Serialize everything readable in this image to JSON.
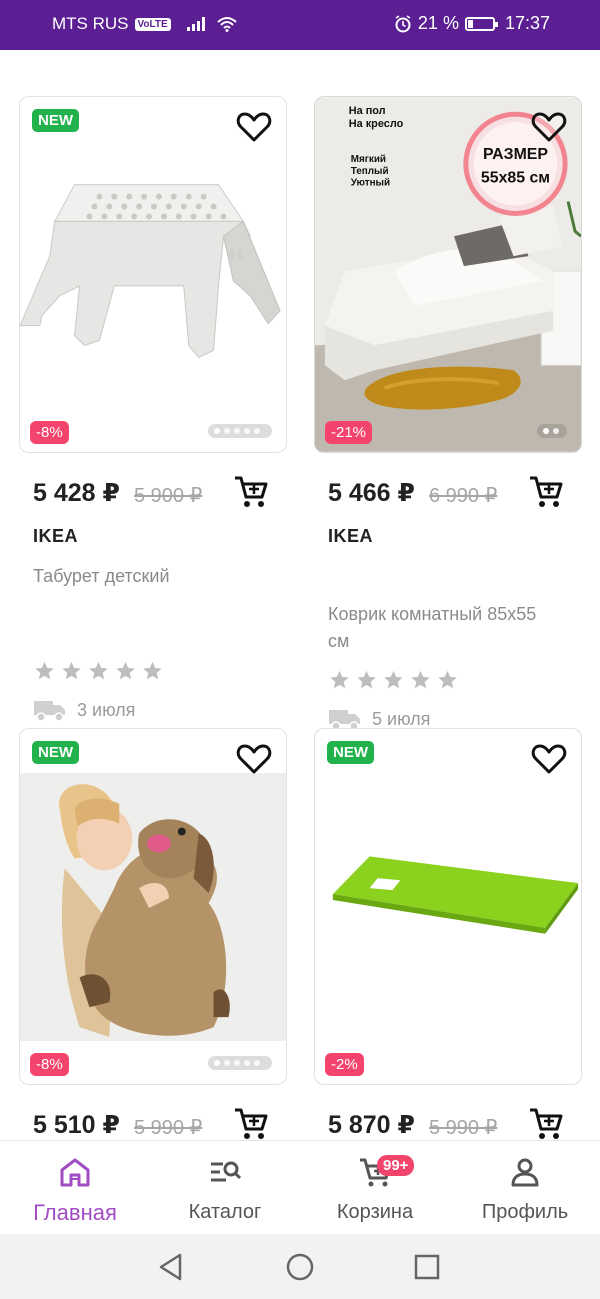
{
  "status_bar": {
    "carrier": "MTS RUS",
    "volte": "VoLTE",
    "battery_percent": "21 %",
    "battery_level": 0.21,
    "time": "17:37"
  },
  "colors": {
    "status_bar_bg": "#5b1f93",
    "new_badge": "#21b24c",
    "discount_badge": "#f2446c",
    "active_nav": "#a24cc4",
    "cart_badge": "#f0446c"
  },
  "products": [
    {
      "new_label": "NEW",
      "discount": "-8%",
      "price": "5 428 ₽",
      "old_price": "5 900 ₽",
      "brand": "IKEA",
      "title": "Табурет детский",
      "rating": 0,
      "delivery": "3 июля",
      "image": "white-step-stool",
      "image_pages": 5
    },
    {
      "discount": "-21%",
      "price": "5 466 ₽",
      "old_price": "6 990 ₽",
      "brand": "IKEA",
      "title": "Коврик комнатный 85x55 см",
      "rating": 0,
      "delivery": "5 июля",
      "image": "bedroom-rug",
      "image_pages": 2,
      "image_text": {
        "top_left": "На пол\nНа кресло",
        "mid_left": "Мягкий\nТеплый\nУютный",
        "circle_line1": "РАЗМЕР",
        "circle_line2": "55х85 см"
      }
    },
    {
      "new_label": "NEW",
      "discount": "-8%",
      "price": "5 510 ₽",
      "old_price": "5 990 ₽",
      "image": "girl-with-plush-dog",
      "image_pages": 5
    },
    {
      "new_label": "NEW",
      "discount": "-2%",
      "price": "5 870 ₽",
      "old_price": "5 990 ₽",
      "image": "green-cutting-board",
      "image_pages": 0
    }
  ],
  "bottom_nav": {
    "items": [
      {
        "label": "Главная",
        "icon": "home-icon",
        "active": true
      },
      {
        "label": "Каталог",
        "icon": "catalog-search-icon"
      },
      {
        "label": "Корзина",
        "icon": "cart-icon",
        "badge": "99+"
      },
      {
        "label": "Профиль",
        "icon": "profile-icon"
      }
    ]
  },
  "system_nav": [
    "back-icon",
    "home-circle-icon",
    "recents-icon"
  ]
}
